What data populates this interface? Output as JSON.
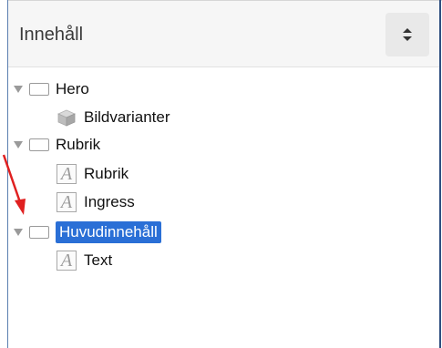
{
  "header": {
    "title": "Innehåll",
    "sort_icon": "sort-updown-icon"
  },
  "tree": {
    "items": [
      {
        "label": "Hero",
        "icon": "block-icon",
        "expanded": true
      },
      {
        "label": "Bildvarianter",
        "icon": "cube-icon"
      },
      {
        "label": "Rubrik",
        "icon": "block-icon",
        "expanded": true
      },
      {
        "label": "Rubrik",
        "icon": "text-a-icon"
      },
      {
        "label": "Ingress",
        "icon": "text-a-icon"
      },
      {
        "label": "Huvudinnehåll",
        "icon": "block-icon",
        "expanded": true,
        "selected": true
      },
      {
        "label": "Text",
        "icon": "text-a-icon"
      }
    ]
  },
  "colors": {
    "selection_bg": "#2a6fd6",
    "annotation_arrow": "#e02020",
    "header_bg": "#f6f6f6"
  }
}
